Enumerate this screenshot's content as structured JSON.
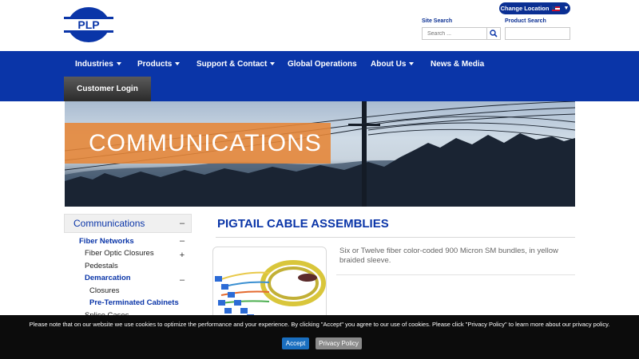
{
  "header": {
    "logo_text": "PLP",
    "change_location": "Change Location",
    "site_search_label": "Site Search",
    "site_search_placeholder": "Search ...",
    "product_search_label": "Product Search",
    "product_search_placeholder": ""
  },
  "nav": {
    "items": [
      "Industries",
      "Products",
      "Support & Contact",
      "Global Operations",
      "About Us",
      "News & Media"
    ],
    "customer_login": "Customer Login"
  },
  "banner": {
    "title": "COMMUNICATIONS"
  },
  "sidebar": {
    "heading": "Communications",
    "heading_toggle": "–",
    "items": [
      {
        "label": "Fiber Networks",
        "toggle": "–"
      },
      {
        "label": "Fiber Optic Closures",
        "toggle": "+"
      },
      {
        "label": "Pedestals",
        "toggle": ""
      },
      {
        "label": "Demarcation",
        "toggle": "–"
      },
      {
        "label": "Closures",
        "toggle": ""
      },
      {
        "label": "Pre-Terminated Cabinets",
        "toggle": ""
      },
      {
        "label": "Splice Cases",
        "toggle": ""
      }
    ]
  },
  "main": {
    "title": "PIGTAIL CABLE ASSEMBLIES",
    "description": "Six or Twelve fiber color-coded 900 Micron SM bundles, in yellow braided sleeve."
  },
  "cookie": {
    "text": "Please note that on our website we use cookies to optimize the performance and your experience. By clicking \"Accept\" you agree to our use of cookies. Please click \"Privacy Policy\" to learn more about our privacy policy.",
    "accept": "Accept",
    "privacy": "Privacy Policy"
  },
  "colors": {
    "brand_blue": "#0a35a8",
    "banner_orange": "#e68536",
    "cookie_bg": "#0c0c0c",
    "accept_blue": "#1a6fc0"
  }
}
